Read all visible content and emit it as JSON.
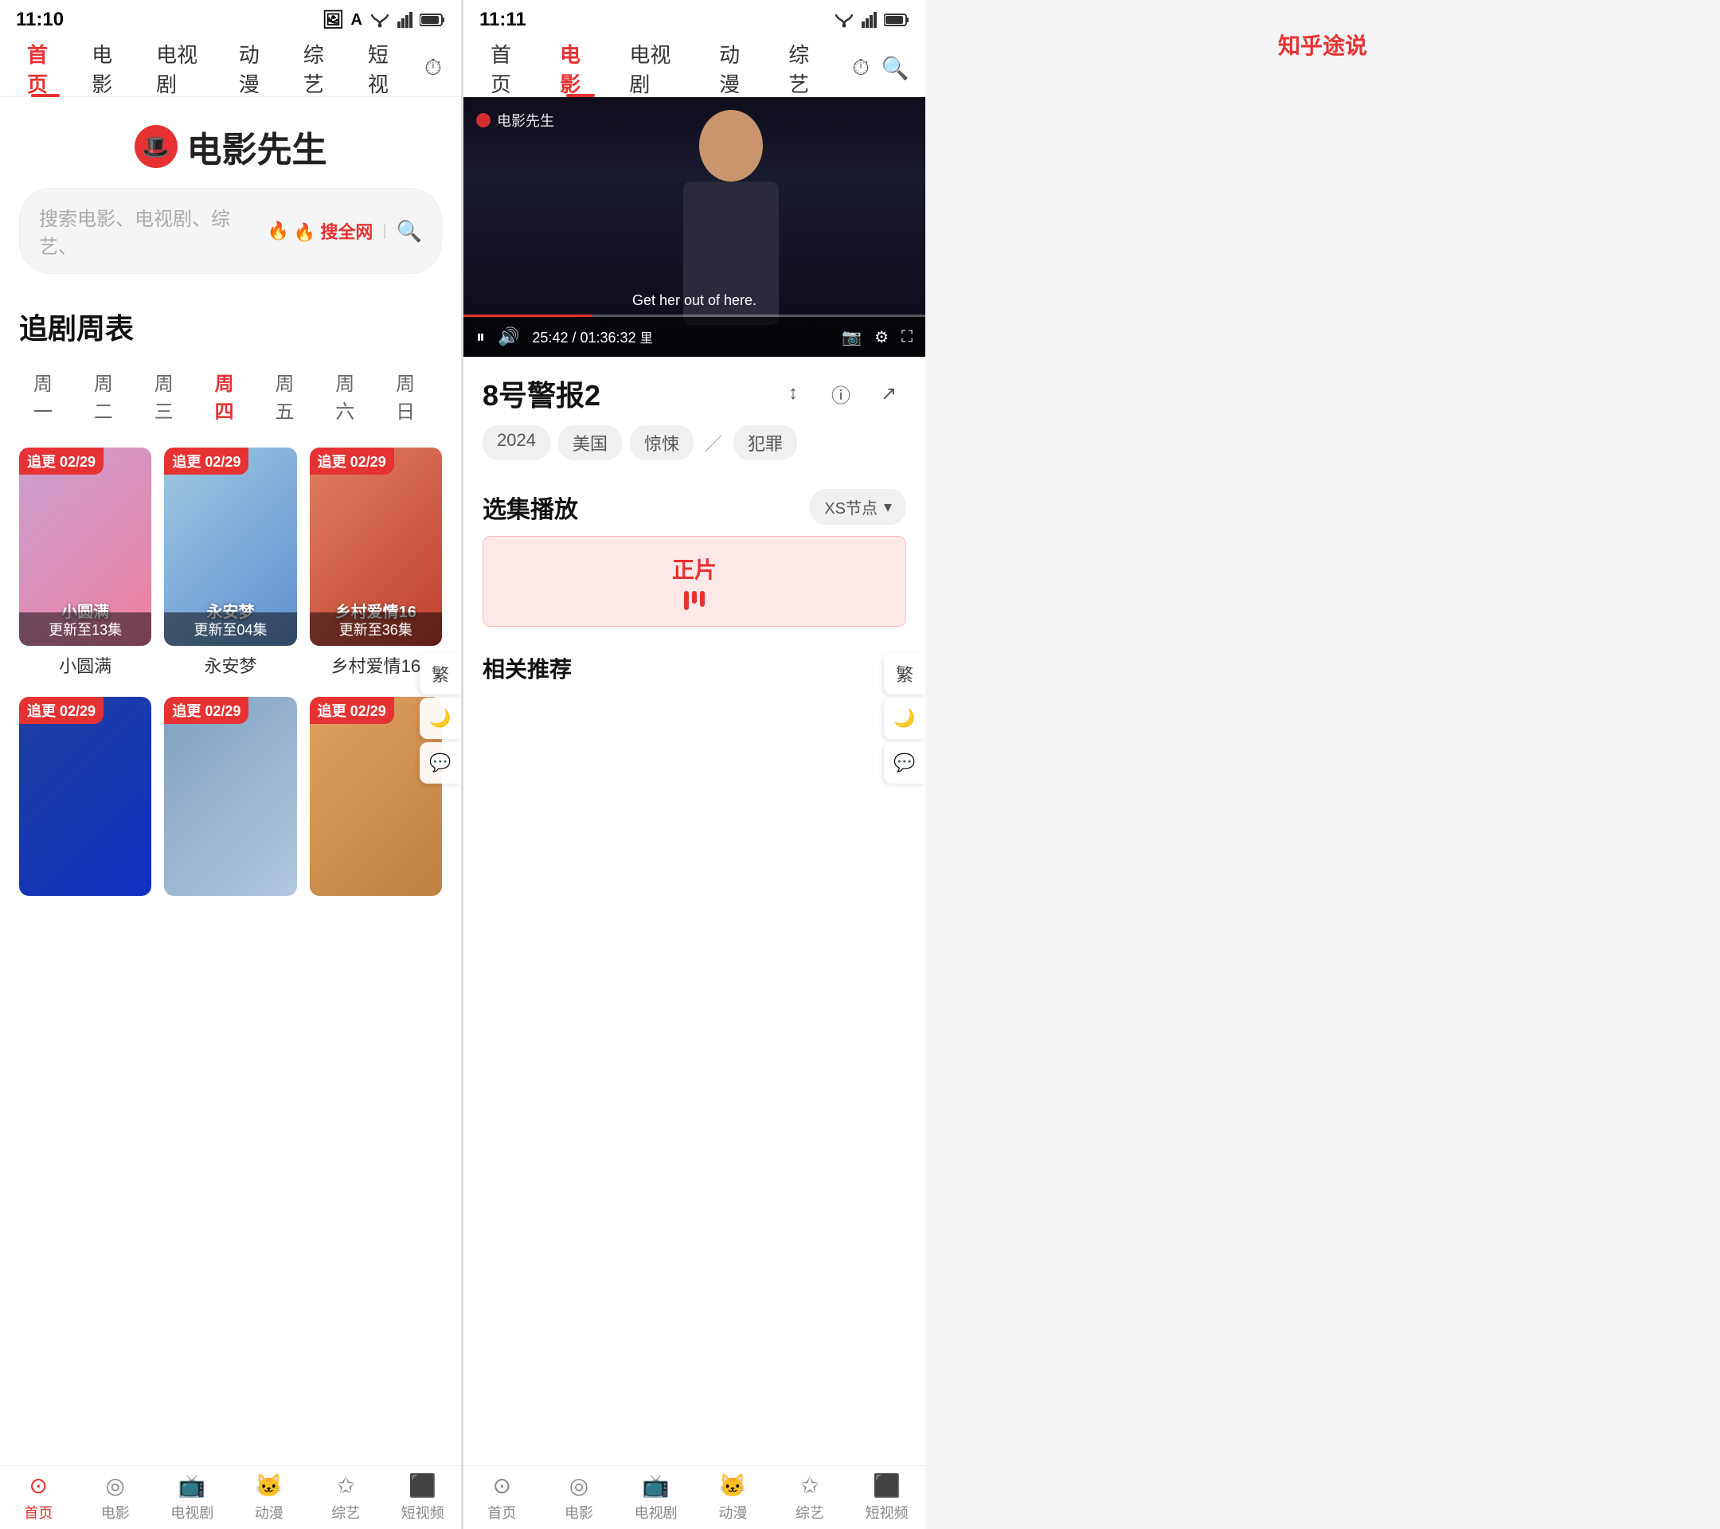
{
  "left_screen": {
    "status_bar": {
      "time": "11:10",
      "icons": [
        "image-icon",
        "a-icon"
      ]
    },
    "nav": {
      "items": [
        {
          "label": "首页",
          "active": true
        },
        {
          "label": "电影",
          "active": false
        },
        {
          "label": "电视剧",
          "active": false
        },
        {
          "label": "动漫",
          "active": false
        },
        {
          "label": "综艺",
          "active": false
        },
        {
          "label": "短视",
          "active": false
        }
      ],
      "history_icon": "⏱"
    },
    "logo": {
      "hat": "🎩",
      "text": "电影先生"
    },
    "search": {
      "placeholder": "搜索电影、电视剧、综艺、",
      "hot_label": "🔥 搜全网",
      "divider": "|"
    },
    "section_title": "追剧周表",
    "week_tabs": [
      {
        "label": "周一",
        "active": false
      },
      {
        "label": "周二",
        "active": false
      },
      {
        "label": "周三",
        "active": false
      },
      {
        "label": "周四",
        "active": true
      },
      {
        "label": "周五",
        "active": false
      },
      {
        "label": "周六",
        "active": false
      },
      {
        "label": "周日",
        "active": false
      }
    ],
    "shows": [
      {
        "badge": "追更 02/29",
        "title": "小圆满",
        "progress": "更新至13集",
        "poster_class": "poster-1"
      },
      {
        "badge": "追更 02/29",
        "title": "永安梦",
        "progress": "更新至04集",
        "poster_class": "poster-2"
      },
      {
        "badge": "追更 02/29",
        "title": "乡村爱情16",
        "progress": "更新至36集",
        "poster_class": "poster-3"
      },
      {
        "badge": "追更 02/29",
        "title": "",
        "progress": "",
        "poster_class": "poster-4"
      },
      {
        "badge": "追更 02/29",
        "title": "",
        "progress": "",
        "poster_class": "poster-5"
      },
      {
        "badge": "追更 02/29",
        "title": "",
        "progress": "",
        "poster_class": "poster-6"
      }
    ],
    "float_btns": [
      "繁",
      "🌙",
      "💬"
    ],
    "bottom_nav": [
      {
        "icon": "⊙",
        "label": "首页",
        "active": true
      },
      {
        "icon": "◎",
        "label": "电影",
        "active": false
      },
      {
        "icon": "📺",
        "label": "电视剧",
        "active": false
      },
      {
        "icon": "🐱",
        "label": "动漫",
        "active": false
      },
      {
        "icon": "✩",
        "label": "综艺",
        "active": false
      },
      {
        "icon": "⬛",
        "label": "短视频",
        "active": false
      }
    ]
  },
  "right_screen": {
    "status_bar": {
      "time": "11:11",
      "icons": [
        "image-icon",
        "a-icon"
      ]
    },
    "nav": {
      "items": [
        {
          "label": "首页",
          "active": false
        },
        {
          "label": "电影",
          "active": true
        },
        {
          "label": "电视剧",
          "active": false
        },
        {
          "label": "动漫",
          "active": false
        },
        {
          "label": "综艺",
          "active": false
        }
      ]
    },
    "video": {
      "watermark": "电影先生",
      "subtitle": "Get her out of here.",
      "current_time": "25:42",
      "separator": "/",
      "total_time": "01:36:32",
      "location_label": "里",
      "progress_percent": 28
    },
    "movie": {
      "title": "8号警报2",
      "year": "2024",
      "country": "美国",
      "genre1": "惊悚",
      "slash": "／",
      "genre2": "犯罪"
    },
    "episode_section": {
      "title": "选集播放",
      "filter": "XS节点",
      "active_btn": "正片"
    },
    "more_section": "相关推荐",
    "float_btns": [
      "繁",
      "🌙",
      "💬"
    ],
    "bottom_nav": [
      {
        "icon": "⊙",
        "label": "首页",
        "active": false
      },
      {
        "icon": "◎",
        "label": "电影",
        "active": false
      },
      {
        "icon": "📺",
        "label": "电视剧",
        "active": false
      },
      {
        "icon": "🐱",
        "label": "动漫",
        "active": false
      },
      {
        "icon": "✩",
        "label": "综艺",
        "active": false
      },
      {
        "icon": "⬛",
        "label": "短视频",
        "active": false
      }
    ]
  },
  "extra": {
    "brand": "知乎途说"
  }
}
